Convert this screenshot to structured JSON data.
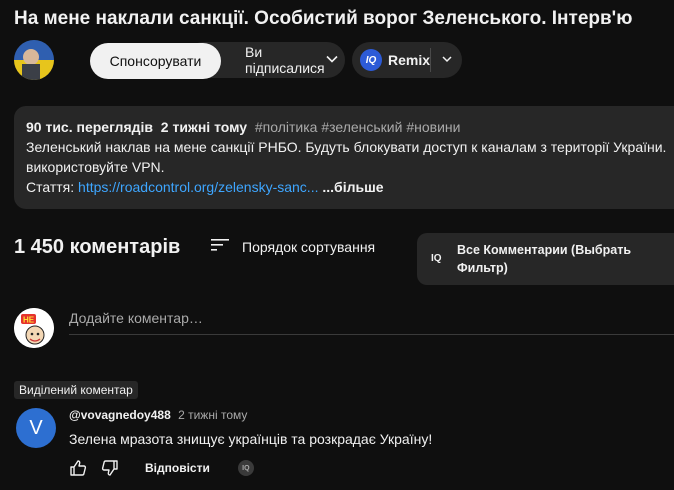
{
  "video": {
    "title": "На мене наклали санкції. Особистий ворог Зеленського. Інтерв'ю"
  },
  "channel": {
    "sponsor_label": "Спонсорувати",
    "subscribed_label": "Ви підписалися",
    "remix_label": "Remix",
    "iq_badge": "IQ"
  },
  "description": {
    "views": "90 тис. переглядів",
    "age": "2 тижні тому",
    "tags": "#політика #зеленський #новини",
    "line1": "Зеленський наклав на мене санкції РНБО. Будуть блокувати доступ к каналам з території України.",
    "line2": "використовуйте VPN.",
    "article_label": "Стаття:",
    "article_link": "https://roadcontrol.org/zelensky-sanc...",
    "more_label": "...більше"
  },
  "comments": {
    "count_label": "1 450 коментарів",
    "sort_label": "Порядок сортування",
    "iq_filter_line1": "Все Комментарии (Выбрать",
    "iq_filter_line2": "Фильтр)",
    "add_placeholder": "Додайте коментар…",
    "pinned_label": "Виділений коментар",
    "items": [
      {
        "avatar_letter": "V",
        "author": "@vovagnedoy488",
        "time": "2 тижні тому",
        "text": "Зелена мразота знищує українців та розкрадає Україну!",
        "reply_label": "Відповісти",
        "iq_mini": "IQ"
      }
    ]
  },
  "colors": {
    "background": "#0f0f0f",
    "surface": "#272727",
    "link": "#3ea6ff",
    "iq_blue": "#2d5bd7",
    "avatar_blue": "#2d6fd1"
  }
}
